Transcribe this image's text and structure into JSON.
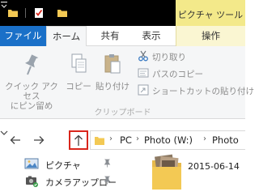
{
  "title_bar": {
    "context_tab_header": "ピクチャ ツール"
  },
  "tabs": {
    "file": "ファイル",
    "home": "ホーム",
    "share": "共有",
    "view": "表示",
    "manage": "操作"
  },
  "ribbon": {
    "pin_quick_access": [
      "クイック アクセス",
      "にピン留め"
    ],
    "copy": "コピー",
    "paste": "貼り付け",
    "cut": "切り取り",
    "copy_path": "パスのコピー",
    "paste_shortcut": "ショートカットの貼り付け",
    "group_clipboard": "クリップボード"
  },
  "address_bar": {
    "crumbs": [
      "PC",
      "Photo (W:)",
      "Photo"
    ],
    "separator": "›"
  },
  "navigation_pane": {
    "items": [
      {
        "label": "ピクチャ",
        "icon": "pictures-icon",
        "pinned": true
      },
      {
        "label": "カメラアップロー",
        "icon": "camera-upload-icon",
        "pinned": true
      }
    ]
  },
  "files": [
    {
      "name": "2015-06-14",
      "type": "folder"
    }
  ],
  "colors": {
    "file_tab": "#1a70c8",
    "context_tab": "#f3e98a",
    "up_button_highlight": "#d9261c",
    "folder": "#f3c954"
  }
}
